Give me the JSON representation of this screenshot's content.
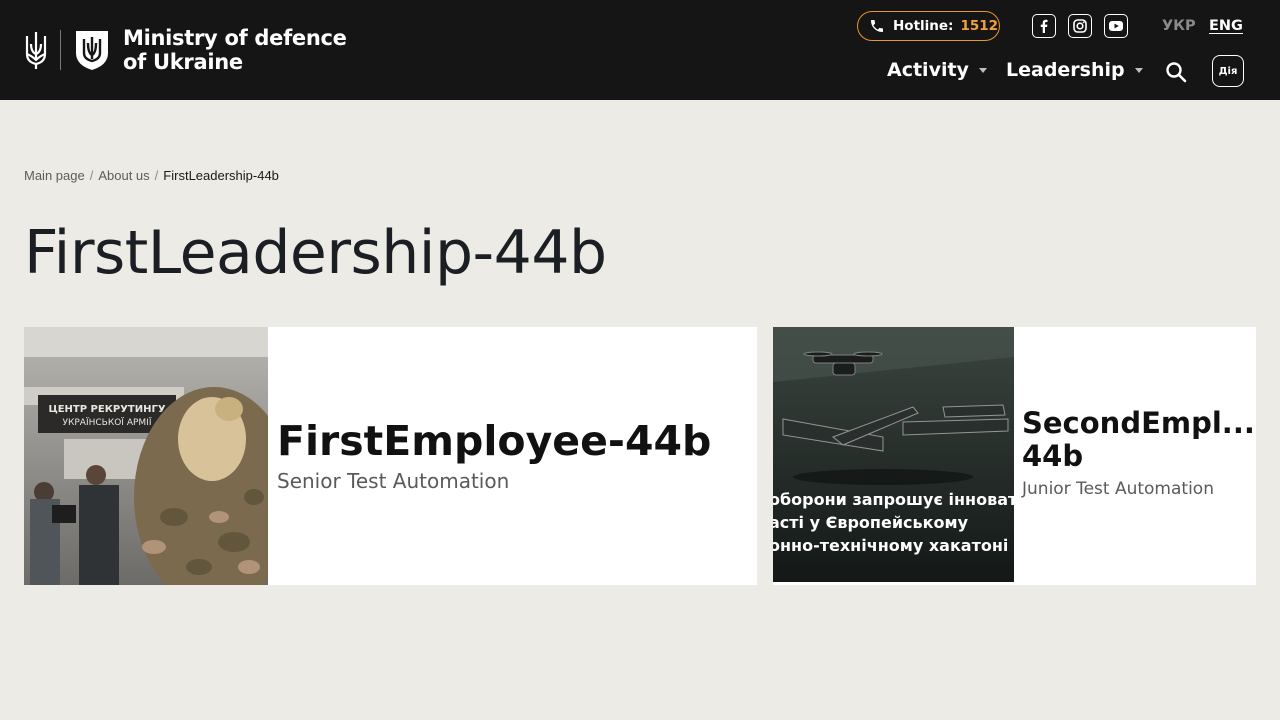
{
  "header": {
    "logo_line1": "Ministry of defence",
    "logo_line2": "of Ukraine",
    "hotline_label": "Hotline:",
    "hotline_number": "1512",
    "social": [
      "facebook-icon",
      "instagram-icon",
      "youtube-icon"
    ],
    "lang_ukr": "УКР",
    "lang_eng": "ENG",
    "nav": [
      {
        "label": "Activity"
      },
      {
        "label": "Leadership"
      }
    ],
    "diia_label": "Дія"
  },
  "breadcrumb": {
    "items": [
      "Main page",
      "About us"
    ],
    "separator": "/",
    "current": "FirstLeadership-44b"
  },
  "page_title": "FirstLeadership-44b",
  "employees": [
    {
      "name": "FirstEmployee-44b",
      "role": "Senior Test Automation",
      "photo_sign_line1": "ЦЕНТР РЕКРУТИНГУ",
      "photo_sign_line2": "УКРАЇНСЬКОЇ АРМІЇ"
    },
    {
      "name_line1": "SecondEmpl...",
      "name_line2": "44b",
      "role": "Junior Test Automation",
      "photo_caption_line1": "оборони запрошує інновато",
      "photo_caption_line2": "асті у Європейському",
      "photo_caption_line3": "онно-технічному хакатоні"
    }
  ],
  "colors": {
    "header_bg": "#151515",
    "page_bg": "#ecebe6",
    "accent_orange": "#f2a23a"
  }
}
